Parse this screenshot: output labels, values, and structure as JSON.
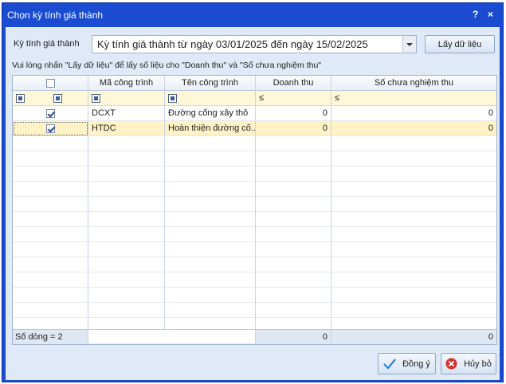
{
  "window": {
    "title": "Chọn kỳ tính giá thành",
    "help_label": "?",
    "close_label": "×"
  },
  "period": {
    "label": "Kỳ tính giá thành",
    "value": "Kỳ tính giá thành từ ngày 03/01/2025 đến ngày 15/02/2025"
  },
  "load_button": "Lấy dữ liệu",
  "hint": "Vui lòng nhấn \"Lấy dữ liệu\" để lấy số liệu cho \"Doanh thu\" và \"Số chưa nghiệm thu\"",
  "columns": {
    "code": "Mã công trình",
    "name": "Tên công trình",
    "revenue": "Doanh thu",
    "unaccepted": "Số chưa nghiệm thu"
  },
  "filter": {
    "revenue_op": "≤",
    "unaccepted_op": "≤"
  },
  "rows": [
    {
      "checked": true,
      "code": "DCXT",
      "name": "Đường cống xây thô",
      "revenue": "0",
      "unaccepted": "0"
    },
    {
      "checked": true,
      "code": "HTDC",
      "name": "Hoàn thiện đường cố...",
      "revenue": "0",
      "unaccepted": "0"
    }
  ],
  "footer": {
    "count_label": "Số dòng = 2",
    "revenue_total": "0",
    "unaccepted_total": "0"
  },
  "buttons": {
    "ok": "Đồng ý",
    "cancel": "Hủy bỏ"
  },
  "colors": {
    "title_bar": "#1a4bd1",
    "client": "#dfe9f7",
    "filter_row": "#fff8d8",
    "selected_row": "#fff2c6"
  }
}
